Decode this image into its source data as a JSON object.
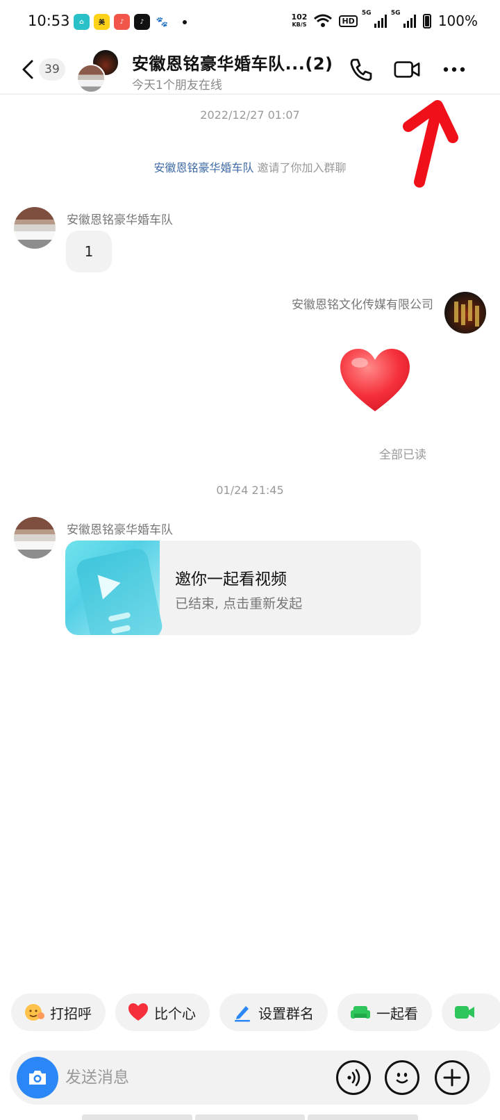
{
  "status_bar": {
    "time": "10:53",
    "net_speed_value": "102",
    "net_speed_unit": "KB/S",
    "hd_label": "HD",
    "sim1_label": "5G",
    "sim2_label": "5G",
    "battery": "100%"
  },
  "header": {
    "unread_count": "39",
    "title": "安徽恩铭豪华婚车队...(2)",
    "subtitle": "今天1个朋友在线"
  },
  "messages": {
    "timestamp_1": "2022/12/27 01:07",
    "system": {
      "inviter": "安徽恩铭豪华婚车队",
      "text": " 邀请了你加入群聊"
    },
    "msg1": {
      "sender": "安徽恩铭豪华婚车队",
      "text": "1"
    },
    "msg2": {
      "sender": "安徽恩铭文化传媒有限公司",
      "emoji": "❤️"
    },
    "read_status": "全部已读",
    "timestamp_2": "01/24 21:45",
    "msg3": {
      "sender": "安徽恩铭豪华婚车队",
      "card_title": "邀你一起看视频",
      "card_subtitle": "已结束, 点击重新发起"
    }
  },
  "quick_actions": [
    {
      "label": "打招呼",
      "icon": "wave-emoji-icon"
    },
    {
      "label": "比个心",
      "icon": "heart-icon"
    },
    {
      "label": "设置群名",
      "icon": "pen-icon"
    },
    {
      "label": "一起看",
      "icon": "sofa-icon"
    },
    {
      "label": "",
      "icon": "video-chip-icon"
    }
  ],
  "input": {
    "placeholder": "发送消息"
  },
  "colors": {
    "accent_blue": "#2a87f5",
    "link_blue": "#3d6aa6",
    "annotation_red": "#f0101a",
    "bubble_gray": "#f2f2f2"
  }
}
